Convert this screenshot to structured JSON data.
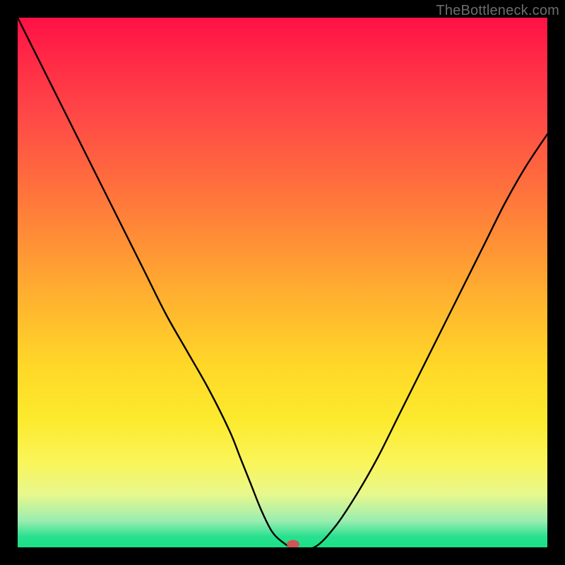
{
  "watermark": "TheBottleneck.com",
  "chart_data": {
    "type": "line",
    "title": "",
    "xlabel": "",
    "ylabel": "",
    "xlim": [
      0,
      100
    ],
    "ylim": [
      0,
      100
    ],
    "series": [
      {
        "name": "curve",
        "x": [
          0,
          4,
          8,
          12,
          16,
          20,
          24,
          28,
          32,
          36,
          40,
          42,
          44,
          46,
          48,
          50,
          52,
          56,
          60,
          64,
          68,
          72,
          76,
          80,
          84,
          88,
          92,
          96,
          100
        ],
        "y": [
          100,
          92,
          84,
          76,
          68,
          60,
          52,
          44,
          37,
          30,
          22,
          17,
          12,
          7,
          3,
          1,
          0,
          0,
          4,
          10,
          17,
          25,
          33,
          41,
          49,
          57,
          65,
          72,
          78
        ]
      }
    ],
    "marker": {
      "x": 52,
      "y": 0.6
    },
    "gradient_stops": [
      {
        "pct": 0,
        "color": "#ff1145"
      },
      {
        "pct": 18,
        "color": "#ff4747"
      },
      {
        "pct": 42,
        "color": "#ff8f36"
      },
      {
        "pct": 66,
        "color": "#ffd828"
      },
      {
        "pct": 84,
        "color": "#faf55a"
      },
      {
        "pct": 95,
        "color": "#9aedb0"
      },
      {
        "pct": 100,
        "color": "#1adf86"
      }
    ]
  }
}
